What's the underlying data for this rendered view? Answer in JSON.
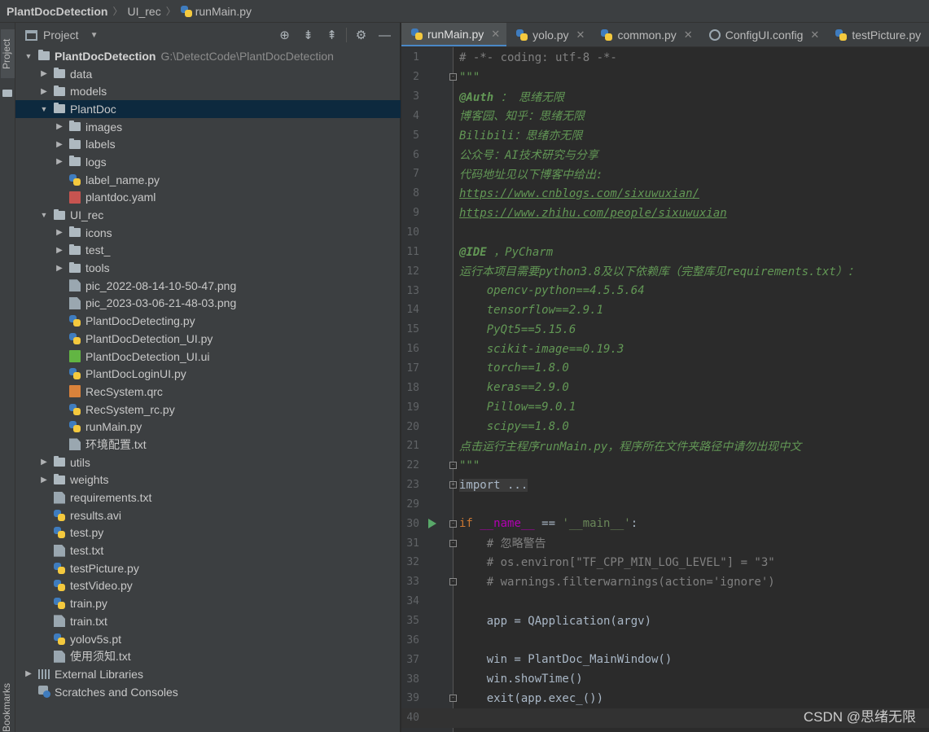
{
  "breadcrumb": [
    "PlantDocDetection",
    "UI_rec",
    "runMain.py"
  ],
  "left_strip": {
    "project_tab": "Project",
    "bookmarks": "Bookmarks"
  },
  "project_panel": {
    "title": "Project",
    "tools": [
      "locate-icon",
      "expand-all-icon",
      "collapse-all-icon",
      "gear-icon",
      "minimize-icon"
    ]
  },
  "tree": [
    {
      "indent": 0,
      "arrow": "down",
      "icon": "folder",
      "label": "PlantDocDetection",
      "path": "G:\\DetectCode\\PlantDocDetection",
      "root": true
    },
    {
      "indent": 1,
      "arrow": "right",
      "icon": "folder",
      "label": "data"
    },
    {
      "indent": 1,
      "arrow": "right",
      "icon": "folder",
      "label": "models"
    },
    {
      "indent": 1,
      "arrow": "down",
      "icon": "folder",
      "label": "PlantDoc",
      "selected": true
    },
    {
      "indent": 2,
      "arrow": "right",
      "icon": "folder",
      "label": "images"
    },
    {
      "indent": 2,
      "arrow": "right",
      "icon": "folder",
      "label": "labels"
    },
    {
      "indent": 2,
      "arrow": "right",
      "icon": "folder",
      "label": "logs"
    },
    {
      "indent": 2,
      "arrow": "none",
      "icon": "py",
      "label": "label_name.py"
    },
    {
      "indent": 2,
      "arrow": "none",
      "icon": "yaml",
      "label": "plantdoc.yaml"
    },
    {
      "indent": 1,
      "arrow": "down",
      "icon": "folder",
      "label": "UI_rec"
    },
    {
      "indent": 2,
      "arrow": "right",
      "icon": "folder",
      "label": "icons"
    },
    {
      "indent": 2,
      "arrow": "right",
      "icon": "folder",
      "label": "test_"
    },
    {
      "indent": 2,
      "arrow": "right",
      "icon": "folder",
      "label": "tools"
    },
    {
      "indent": 2,
      "arrow": "none",
      "icon": "img",
      "label": "pic_2022-08-14-10-50-47.png"
    },
    {
      "indent": 2,
      "arrow": "none",
      "icon": "img",
      "label": "pic_2023-03-06-21-48-03.png"
    },
    {
      "indent": 2,
      "arrow": "none",
      "icon": "py",
      "label": "PlantDocDetecting.py"
    },
    {
      "indent": 2,
      "arrow": "none",
      "icon": "py",
      "label": "PlantDocDetection_UI.py"
    },
    {
      "indent": 2,
      "arrow": "none",
      "icon": "ui",
      "label": "PlantDocDetection_UI.ui"
    },
    {
      "indent": 2,
      "arrow": "none",
      "icon": "py",
      "label": "PlantDocLoginUI.py"
    },
    {
      "indent": 2,
      "arrow": "none",
      "icon": "qrc",
      "label": "RecSystem.qrc"
    },
    {
      "indent": 2,
      "arrow": "none",
      "icon": "py",
      "label": "RecSystem_rc.py"
    },
    {
      "indent": 2,
      "arrow": "none",
      "icon": "py",
      "label": "runMain.py"
    },
    {
      "indent": 2,
      "arrow": "none",
      "icon": "txt",
      "label": "环境配置.txt"
    },
    {
      "indent": 1,
      "arrow": "right",
      "icon": "folder",
      "label": "utils"
    },
    {
      "indent": 1,
      "arrow": "right",
      "icon": "folder",
      "label": "weights"
    },
    {
      "indent": 1,
      "arrow": "none",
      "icon": "txt",
      "label": "requirements.txt"
    },
    {
      "indent": 1,
      "arrow": "none",
      "icon": "py",
      "label": "results.avi"
    },
    {
      "indent": 1,
      "arrow": "none",
      "icon": "py",
      "label": "test.py"
    },
    {
      "indent": 1,
      "arrow": "none",
      "icon": "txt",
      "label": "test.txt"
    },
    {
      "indent": 1,
      "arrow": "none",
      "icon": "py",
      "label": "testPicture.py"
    },
    {
      "indent": 1,
      "arrow": "none",
      "icon": "py",
      "label": "testVideo.py"
    },
    {
      "indent": 1,
      "arrow": "none",
      "icon": "py",
      "label": "train.py"
    },
    {
      "indent": 1,
      "arrow": "none",
      "icon": "txt",
      "label": "train.txt"
    },
    {
      "indent": 1,
      "arrow": "none",
      "icon": "py",
      "label": "yolov5s.pt"
    },
    {
      "indent": 1,
      "arrow": "none",
      "icon": "txt",
      "label": "使用须知.txt"
    },
    {
      "indent": 0,
      "arrow": "right",
      "icon": "lib",
      "label": "External Libraries"
    },
    {
      "indent": 0,
      "arrow": "none",
      "icon": "scratch",
      "label": "Scratches and Consoles"
    }
  ],
  "tabs": [
    {
      "label": "runMain.py",
      "icon": "py",
      "active": true
    },
    {
      "label": "yolo.py",
      "icon": "py"
    },
    {
      "label": "common.py",
      "icon": "py"
    },
    {
      "label": "ConfigUI.config",
      "icon": "config"
    },
    {
      "label": "testPicture.py",
      "icon": "py"
    }
  ],
  "code_lines": [
    {
      "n": "1",
      "fold": "",
      "segs": [
        [
          "c-comment",
          "# -*- coding: utf-8 -*-"
        ]
      ]
    },
    {
      "n": "2",
      "fold": "-",
      "segs": [
        [
          "c-doc",
          "\"\"\""
        ]
      ]
    },
    {
      "n": "3",
      "fold": "",
      "segs": [
        [
          "c-doc-b",
          "@Auth"
        ],
        [
          "c-doc",
          " ： 思绪无限"
        ]
      ]
    },
    {
      "n": "4",
      "fold": "",
      "segs": [
        [
          "c-doc",
          "博客园、知乎：思绪无限"
        ]
      ]
    },
    {
      "n": "5",
      "fold": "",
      "segs": [
        [
          "c-doc",
          "Bilibili：思绪亦无限"
        ]
      ]
    },
    {
      "n": "6",
      "fold": "",
      "segs": [
        [
          "c-doc",
          "公众号：AI技术研究与分享"
        ]
      ]
    },
    {
      "n": "7",
      "fold": "",
      "segs": [
        [
          "c-doc",
          "代码地址见以下博客中给出:"
        ]
      ]
    },
    {
      "n": "8",
      "fold": "",
      "segs": [
        [
          "c-link",
          "https://www.cnblogs.com/sixuwuxian/"
        ]
      ]
    },
    {
      "n": "9",
      "fold": "",
      "segs": [
        [
          "c-link",
          "https://www.zhihu.com/people/sixuwuxian"
        ]
      ]
    },
    {
      "n": "10",
      "fold": "",
      "segs": []
    },
    {
      "n": "11",
      "fold": "",
      "segs": [
        [
          "c-doc-b",
          "@IDE"
        ],
        [
          "c-doc",
          " ，PyCharm"
        ]
      ]
    },
    {
      "n": "12",
      "fold": "",
      "segs": [
        [
          "c-doc",
          "运行本项目需要python3.8及以下依赖库（完整库见requirements.txt）："
        ]
      ]
    },
    {
      "n": "13",
      "fold": "",
      "segs": [
        [
          "c-doc",
          "    opencv-python==4.5.5.64"
        ]
      ]
    },
    {
      "n": "14",
      "fold": "",
      "segs": [
        [
          "c-doc",
          "    tensorflow==2.9.1"
        ]
      ]
    },
    {
      "n": "15",
      "fold": "",
      "segs": [
        [
          "c-doc",
          "    PyQt5==5.15.6"
        ]
      ]
    },
    {
      "n": "16",
      "fold": "",
      "segs": [
        [
          "c-doc",
          "    scikit-image==0.19.3"
        ]
      ]
    },
    {
      "n": "17",
      "fold": "",
      "segs": [
        [
          "c-doc",
          "    torch==1.8.0"
        ]
      ]
    },
    {
      "n": "18",
      "fold": "",
      "segs": [
        [
          "c-doc",
          "    keras==2.9.0"
        ]
      ]
    },
    {
      "n": "19",
      "fold": "",
      "segs": [
        [
          "c-doc",
          "    Pillow==9.0.1"
        ]
      ]
    },
    {
      "n": "20",
      "fold": "",
      "segs": [
        [
          "c-doc",
          "    scipy==1.8.0"
        ]
      ]
    },
    {
      "n": "21",
      "fold": "",
      "segs": [
        [
          "c-doc",
          "点击运行主程序runMain.py，程序所在文件夹路径中请勿出现中文"
        ]
      ]
    },
    {
      "n": "22",
      "fold": "-",
      "segs": [
        [
          "c-doc",
          "\"\"\""
        ]
      ]
    },
    {
      "n": "23",
      "fold": "+",
      "segs": [
        [
          "c-fold-import",
          "import ..."
        ]
      ]
    },
    {
      "n": "29",
      "fold": "",
      "segs": []
    },
    {
      "n": "30",
      "fold": "-",
      "run": true,
      "segs": [
        [
          "c-kw",
          "if "
        ],
        [
          "c-dunder",
          "__name__"
        ],
        [
          "",
          " == "
        ],
        [
          "c-str",
          "'__main__'"
        ],
        [
          "",
          ":"
        ]
      ]
    },
    {
      "n": "31",
      "fold": "-",
      "segs": [
        [
          "c-comment",
          "    # 忽略警告"
        ]
      ]
    },
    {
      "n": "32",
      "fold": "",
      "segs": [
        [
          "c-comment",
          "    # os.environ[\"TF_CPP_MIN_LOG_LEVEL\"] = \"3\""
        ]
      ]
    },
    {
      "n": "33",
      "fold": "-",
      "segs": [
        [
          "c-comment",
          "    # warnings.filterwarnings(action='ignore')"
        ]
      ]
    },
    {
      "n": "34",
      "fold": "",
      "segs": []
    },
    {
      "n": "35",
      "fold": "",
      "segs": [
        [
          "",
          "    app = QApplication(argv)"
        ]
      ]
    },
    {
      "n": "36",
      "fold": "",
      "segs": []
    },
    {
      "n": "37",
      "fold": "",
      "segs": [
        [
          "",
          "    win = PlantDoc_MainWindow()"
        ]
      ]
    },
    {
      "n": "38",
      "fold": "",
      "segs": [
        [
          "",
          "    win.showTime()"
        ]
      ]
    },
    {
      "n": "39",
      "fold": "-",
      "segs": [
        [
          "",
          "    exit(app.exec_())"
        ]
      ]
    },
    {
      "n": "40",
      "fold": "",
      "current": true,
      "segs": []
    }
  ],
  "watermark": "CSDN @思绪无限"
}
